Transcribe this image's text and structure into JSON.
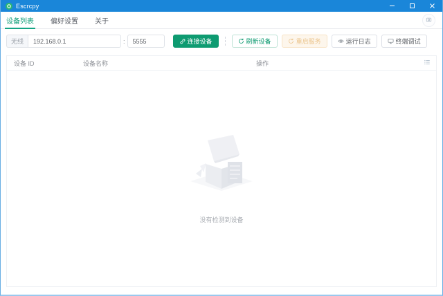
{
  "window": {
    "title": "Escrcpy"
  },
  "tabs": {
    "device_list": "设备列表",
    "preferences": "偏好设置",
    "about": "关于"
  },
  "toolbar": {
    "wireless_label": "无线",
    "ip_value": "192.168.0.1",
    "separator": ":",
    "port_value": "5555",
    "connect_label": "连接设备",
    "refresh_label": "刷新设备",
    "restart_label": "重启服务",
    "log_label": "运行日志",
    "terminal_label": "终端调试"
  },
  "table": {
    "col_device_id": "设备 ID",
    "col_device_name": "设备名称",
    "col_actions": "操作"
  },
  "empty": {
    "text": "没有检测到设备"
  },
  "icons": {
    "app_logo": "escrcpy-logo-icon",
    "connect": "link-icon",
    "refresh": "refresh-icon",
    "restart": "restart-icon",
    "logs": "eye-icon",
    "terminal": "monitor-icon",
    "tab_corner": "camera-icon",
    "header_menu": "list-icon",
    "minimize": "minimize-icon",
    "maximize": "maximize-icon",
    "close": "close-icon"
  },
  "colors": {
    "titlebar_blue": "#1a86d9",
    "primary_green": "#0e9b71",
    "warning_orange": "#e6a23c"
  }
}
